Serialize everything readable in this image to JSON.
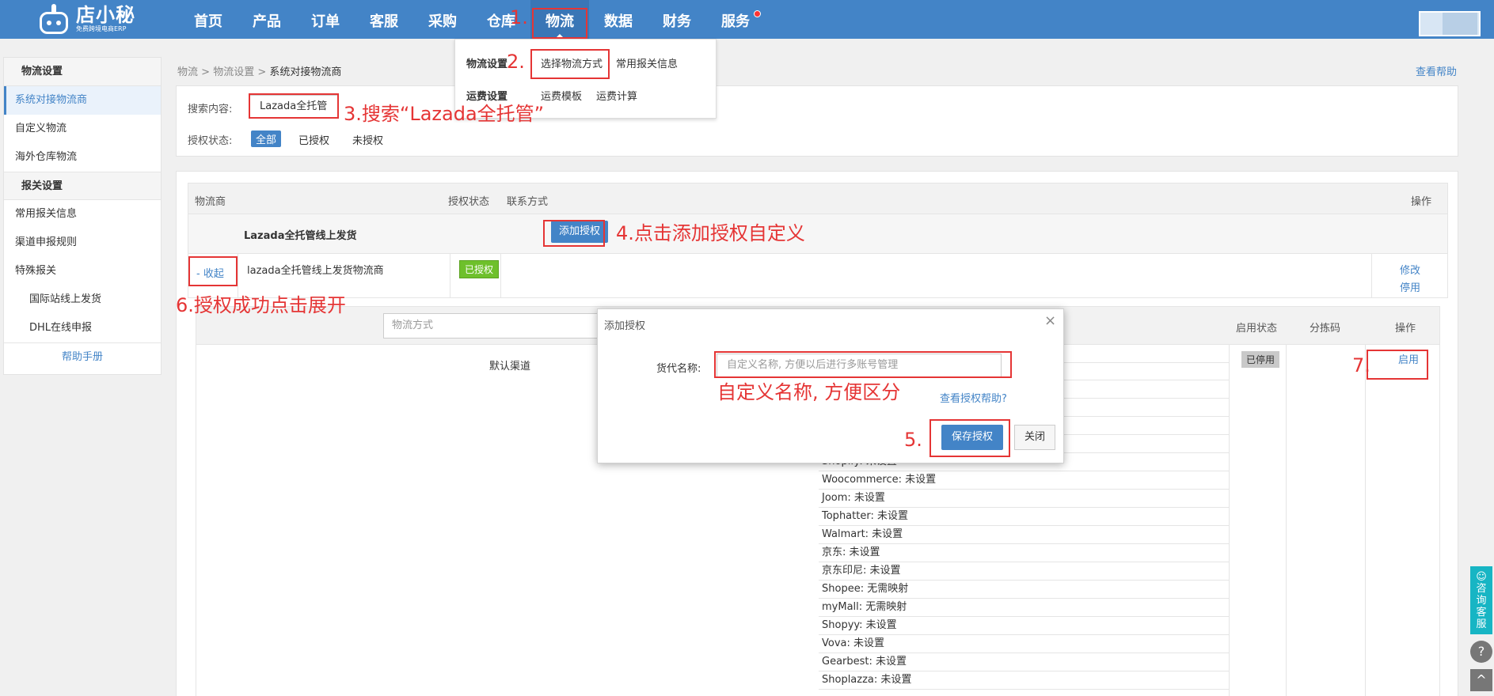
{
  "logo": {
    "main": "店小秘",
    "sub": "免费跨境电商ERP"
  },
  "nav": [
    "首页",
    "产品",
    "订单",
    "客服",
    "采购",
    "仓库",
    "物流",
    "数据",
    "财务",
    "服务"
  ],
  "dropdown": {
    "group1": "物流设置",
    "link1": "选择物流方式",
    "link2": "常用报关信息",
    "group2": "运费设置",
    "link3": "运费模板",
    "link4": "运费计算"
  },
  "sidebar": {
    "head1": "物流设置",
    "items1": [
      "系统对接物流商",
      "自定义物流",
      "海外仓库物流"
    ],
    "head2": "报关设置",
    "items2": [
      "常用报关信息",
      "渠道申报规则",
      "特殊报关"
    ],
    "sub_items": [
      "国际站线上发货",
      "DHL在线申报"
    ],
    "help": "帮助手册"
  },
  "breadcrumb": {
    "a": "物流",
    "b": "物流设置",
    "c": "系统对接物流商",
    "sep": ">"
  },
  "help_link": "查看帮助",
  "search": {
    "label": "搜索内容:",
    "value": "Lazada全托管",
    "status_label": "授权状态:",
    "filters": [
      "全部",
      "已授权",
      "未授权"
    ]
  },
  "table": {
    "headers": {
      "provider": "物流商",
      "auth_status": "授权状态",
      "contact": "联系方式",
      "ops": "操作"
    },
    "group_title": "Lazada全托管线上发货",
    "add_auth_btn": "添加授权",
    "row": {
      "toggle": "- 收起",
      "name": "lazada全托管线上发货物流商",
      "status": "已授权",
      "op_edit": "修改",
      "op_disable": "停用"
    }
  },
  "subtable": {
    "search_placeholder": "物流方式",
    "headers": {
      "enable_status": "启用状态",
      "sort_code": "分拣码",
      "ops": "操作"
    },
    "channel": "默认渠道",
    "mappings": [
      "Shopify: 未设置",
      "Woocommerce: 未设置",
      "Joom: 未设置",
      "Tophatter: 未设置",
      "Walmart: 未设置",
      "京东: 未设置",
      "京东印尼: 未设置",
      "Shopee: 无需映射",
      "myMall: 无需映射",
      "Shopyy: 未设置",
      "Vova: 未设置",
      "Gearbest: 未设置",
      "Shoplazza: 未设置"
    ],
    "status": "已停用",
    "enable": "启用"
  },
  "modal": {
    "title": "添加授权",
    "close_symbol": "×",
    "label": "货代名称:",
    "placeholder": "自定义名称, 方便以后进行多账号管理",
    "help": "查看授权帮助?",
    "save": "保存授权",
    "close": "关闭"
  },
  "annotations": {
    "a1": "1.",
    "a2": "2.",
    "a3": "3.搜索“Lazada全托管”",
    "a4": "4.点击添加授权自定义",
    "a5": "5.",
    "a6": "6.授权成功点击展开",
    "a7": "7.",
    "note": "自定义名称, 方便区分"
  },
  "float": {
    "cs": "咨询客服",
    "help_icon": "?",
    "top_icon": "^"
  },
  "colors": {
    "brand": "#4384c7",
    "annotation": "#e53535",
    "authorized": "#6ec02b",
    "float_cs": "#17b5c4"
  }
}
